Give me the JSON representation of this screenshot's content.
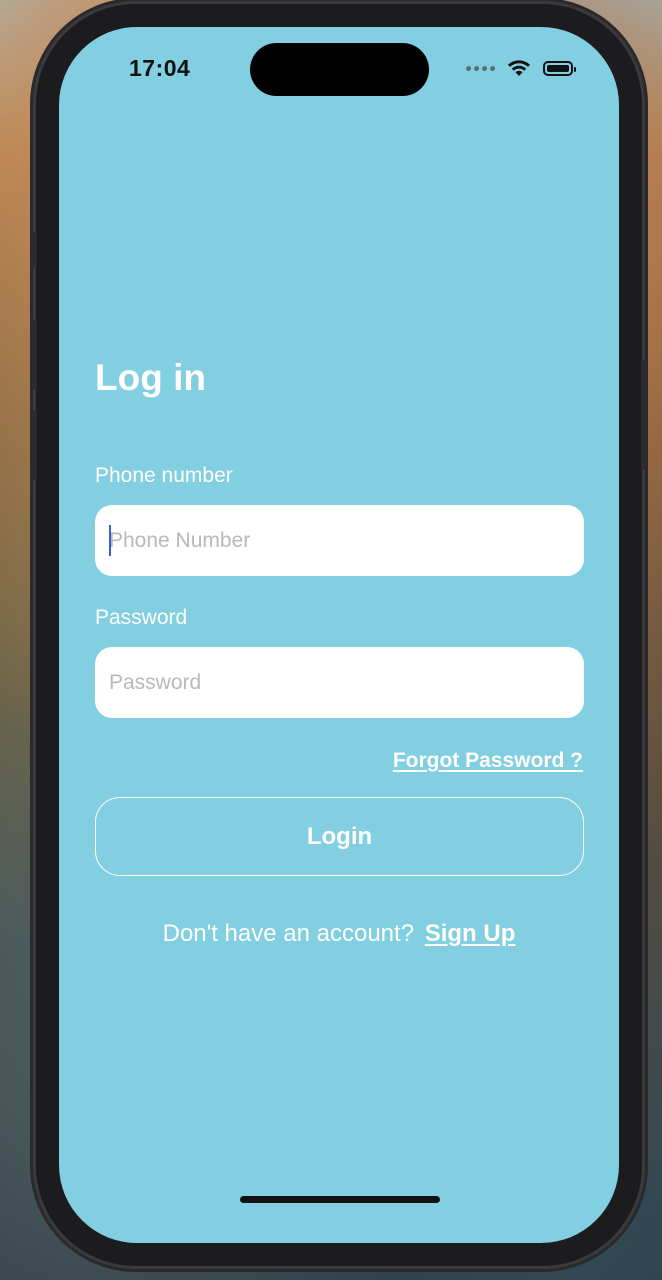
{
  "status_bar": {
    "time": "17:04"
  },
  "login": {
    "title": "Log in",
    "phone_label": "Phone number",
    "phone_placeholder": "Phone Number",
    "phone_value": "",
    "password_label": "Password",
    "password_placeholder": "Password",
    "password_value": "",
    "forgot_password": "Forgot Password ?",
    "login_button": "Login",
    "no_account_text": "Don't have an account?",
    "signup_link": "Sign Up"
  },
  "colors": {
    "screen_background": "#81cfe0",
    "text": "#ffffff",
    "caret": "#3b5bd6"
  },
  "icons": [
    "cellular-signal-icon",
    "wifi-icon",
    "battery-icon"
  ]
}
